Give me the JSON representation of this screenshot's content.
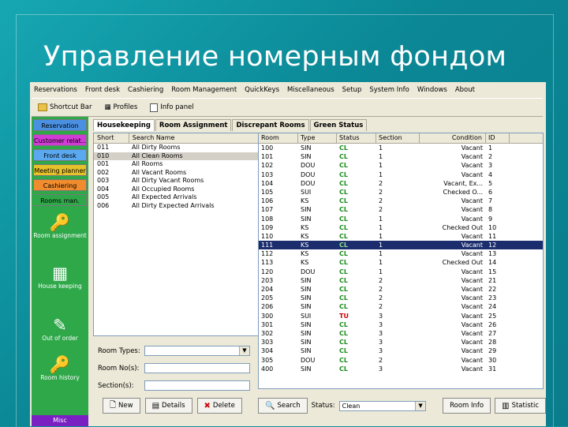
{
  "slide": {
    "title": "Управление номерным фондом"
  },
  "menu": [
    "Reservations",
    "Front desk",
    "Cashiering",
    "Room Management",
    "QuickKeys",
    "Miscellaneous",
    "Setup",
    "System Info",
    "Windows",
    "About"
  ],
  "toolbar": {
    "shortcut_bar": "Shortcut Bar",
    "profiles": "Profiles",
    "info_panel": "Info panel"
  },
  "nav": {
    "buttons": [
      {
        "label": "Reservation",
        "bg": "#4a90e2"
      },
      {
        "label": "Customer relat...",
        "bg": "#d13bd6"
      },
      {
        "label": "Front desk",
        "bg": "#5aa8f0"
      },
      {
        "label": "Meeting planner",
        "bg": "#e6c229"
      },
      {
        "label": "Cashiering",
        "bg": "#f08c2e"
      },
      {
        "label": "Rooms man.",
        "bg": "#2fa84a"
      }
    ],
    "big": [
      "Room assignment",
      "House keeping",
      "Out of order",
      "Room history"
    ],
    "bottom": "Misc"
  },
  "tabs": [
    "Housekeeping",
    "Room Assignment",
    "Discrepant Rooms",
    "Green Status"
  ],
  "left_list": {
    "headers": [
      "Short",
      "Search Name"
    ],
    "rows": [
      [
        "011",
        "All Dirty Rooms"
      ],
      [
        "010",
        "All Clean Rooms"
      ],
      [
        "001",
        "All Rooms"
      ],
      [
        "002",
        "All Vacant Rooms"
      ],
      [
        "003",
        "All Dirty Vacant Rooms"
      ],
      [
        "004",
        "All Occupied Rooms"
      ],
      [
        "005",
        "All Expected Arrivals"
      ],
      [
        "006",
        "All Dirty Expected Arrivals"
      ]
    ],
    "selected": 1
  },
  "filters": {
    "room_types": "Room Types:",
    "room_no": "Room No(s):",
    "sections": "Section(s):"
  },
  "left_buttons": {
    "new": "New",
    "details": "Details",
    "delete": "Delete"
  },
  "room_table": {
    "headers": [
      "Room",
      "Type",
      "Status",
      "Section",
      "Condition",
      "ID"
    ],
    "selected": 11,
    "rows": [
      [
        "100",
        "SIN",
        "CL",
        "1",
        "Vacant",
        "1"
      ],
      [
        "101",
        "SIN",
        "CL",
        "1",
        "Vacant",
        "2"
      ],
      [
        "102",
        "DOU",
        "CL",
        "1",
        "Vacant",
        "3"
      ],
      [
        "103",
        "DOU",
        "CL",
        "1",
        "Vacant",
        "4"
      ],
      [
        "104",
        "DOU",
        "CL",
        "2",
        "Vacant, Ex...",
        "5"
      ],
      [
        "105",
        "SUI",
        "CL",
        "2",
        "Checked O...",
        "6"
      ],
      [
        "106",
        "KS",
        "CL",
        "2",
        "Vacant",
        "7"
      ],
      [
        "107",
        "SIN",
        "CL",
        "2",
        "Vacant",
        "8"
      ],
      [
        "108",
        "SIN",
        "CL",
        "1",
        "Vacant",
        "9"
      ],
      [
        "109",
        "KS",
        "CL",
        "1",
        "Checked Out",
        "10"
      ],
      [
        "110",
        "KS",
        "CL",
        "1",
        "Vacant",
        "11"
      ],
      [
        "111",
        "KS",
        "CL",
        "1",
        "Vacant",
        "12"
      ],
      [
        "112",
        "KS",
        "CL",
        "1",
        "Vacant",
        "13"
      ],
      [
        "113",
        "KS",
        "CL",
        "1",
        "Checked Out",
        "14"
      ],
      [
        "120",
        "DOU",
        "CL",
        "1",
        "Vacant",
        "15"
      ],
      [
        "203",
        "SIN",
        "CL",
        "2",
        "Vacant",
        "21"
      ],
      [
        "204",
        "SIN",
        "CL",
        "2",
        "Vacant",
        "22"
      ],
      [
        "205",
        "SIN",
        "CL",
        "2",
        "Vacant",
        "23"
      ],
      [
        "206",
        "SIN",
        "CL",
        "2",
        "Vacant",
        "24"
      ],
      [
        "300",
        "SUI",
        "TU",
        "3",
        "Vacant",
        "25"
      ],
      [
        "301",
        "SIN",
        "CL",
        "3",
        "Vacant",
        "26"
      ],
      [
        "302",
        "SIN",
        "CL",
        "3",
        "Vacant",
        "27"
      ],
      [
        "303",
        "SIN",
        "CL",
        "3",
        "Vacant",
        "28"
      ],
      [
        "304",
        "SIN",
        "CL",
        "3",
        "Vacant",
        "29"
      ],
      [
        "305",
        "DOU",
        "CL",
        "2",
        "Vacant",
        "30"
      ],
      [
        "400",
        "SIN",
        "CL",
        "3",
        "Vacant",
        "31"
      ]
    ]
  },
  "right_buttons": {
    "search": "Search",
    "status_label": "Status:",
    "status_value": "Clean",
    "room_info": "Room Info",
    "statistics": "Statistic"
  }
}
